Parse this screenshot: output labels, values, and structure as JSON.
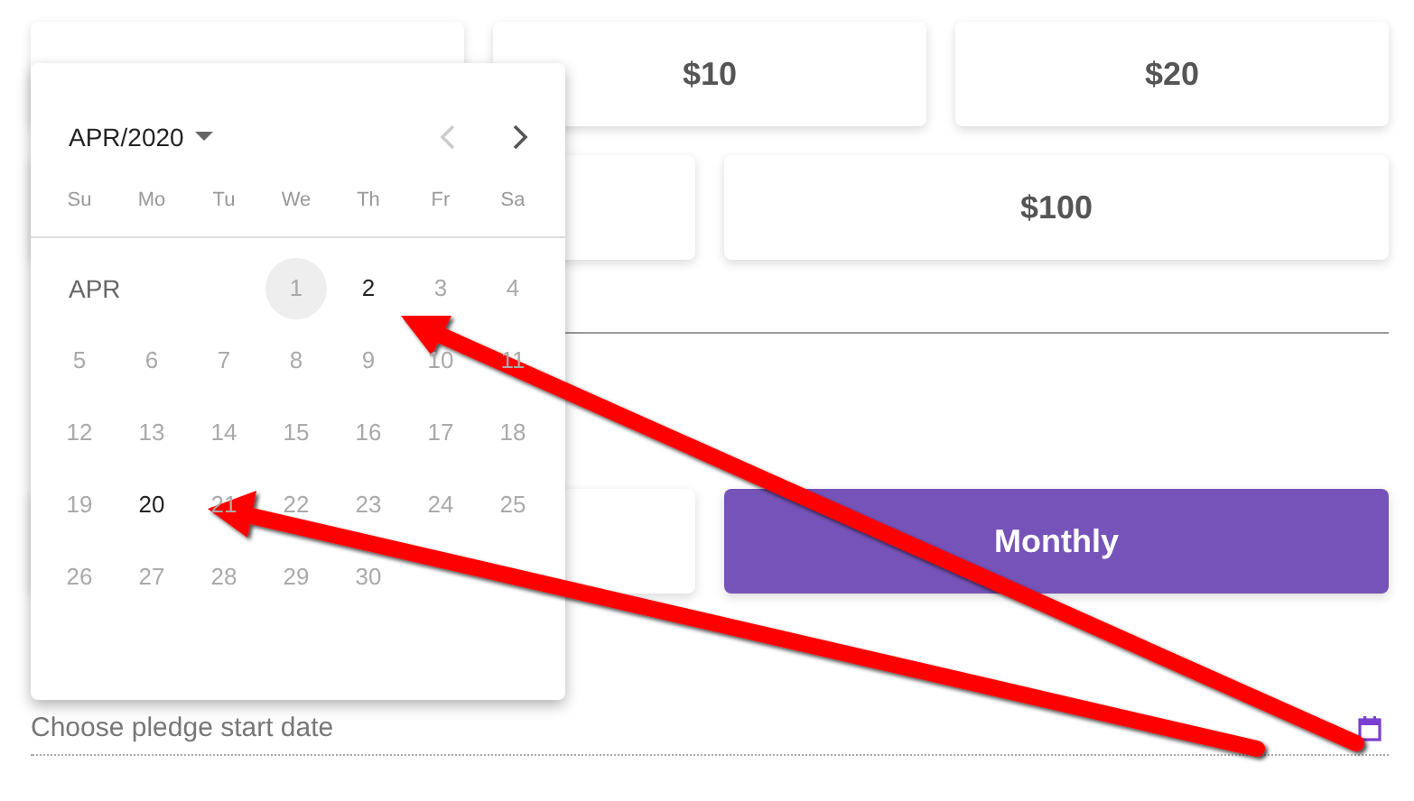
{
  "amount_rows": [
    [
      {
        "label": "$10"
      },
      {
        "label": "$20"
      }
    ],
    [
      {
        "label": "$100"
      }
    ]
  ],
  "frequency": [
    {
      "label": "Monthly",
      "selected": true
    }
  ],
  "date_field": {
    "placeholder": "Choose pledge start date"
  },
  "date_picker": {
    "title": "APR/2020",
    "prev_disabled": true,
    "next_disabled": false,
    "weekdays": [
      "Su",
      "Mo",
      "Tu",
      "We",
      "Th",
      "Fr",
      "Sa"
    ],
    "month_label": "APR",
    "days": [
      {
        "label": "1",
        "disabled": true,
        "today": true
      },
      {
        "label": "2",
        "disabled": false,
        "today": false
      },
      {
        "label": "3",
        "disabled": true,
        "today": false
      },
      {
        "label": "4",
        "disabled": true,
        "today": false
      },
      {
        "label": "5",
        "disabled": true,
        "today": false
      },
      {
        "label": "6",
        "disabled": true,
        "today": false
      },
      {
        "label": "7",
        "disabled": true,
        "today": false
      },
      {
        "label": "8",
        "disabled": true,
        "today": false
      },
      {
        "label": "9",
        "disabled": true,
        "today": false
      },
      {
        "label": "10",
        "disabled": true,
        "today": false
      },
      {
        "label": "11",
        "disabled": true,
        "today": false
      },
      {
        "label": "12",
        "disabled": true,
        "today": false
      },
      {
        "label": "13",
        "disabled": true,
        "today": false
      },
      {
        "label": "14",
        "disabled": true,
        "today": false
      },
      {
        "label": "15",
        "disabled": true,
        "today": false
      },
      {
        "label": "16",
        "disabled": true,
        "today": false
      },
      {
        "label": "17",
        "disabled": true,
        "today": false
      },
      {
        "label": "18",
        "disabled": true,
        "today": false
      },
      {
        "label": "19",
        "disabled": true,
        "today": false
      },
      {
        "label": "20",
        "disabled": false,
        "today": false
      },
      {
        "label": "21",
        "disabled": true,
        "today": false
      },
      {
        "label": "22",
        "disabled": true,
        "today": false
      },
      {
        "label": "23",
        "disabled": true,
        "today": false
      },
      {
        "label": "24",
        "disabled": true,
        "today": false
      },
      {
        "label": "25",
        "disabled": true,
        "today": false
      },
      {
        "label": "26",
        "disabled": true,
        "today": false
      },
      {
        "label": "27",
        "disabled": true,
        "today": false
      },
      {
        "label": "28",
        "disabled": true,
        "today": false
      },
      {
        "label": "29",
        "disabled": true,
        "today": false
      },
      {
        "label": "30",
        "disabled": true,
        "today": false
      }
    ]
  }
}
